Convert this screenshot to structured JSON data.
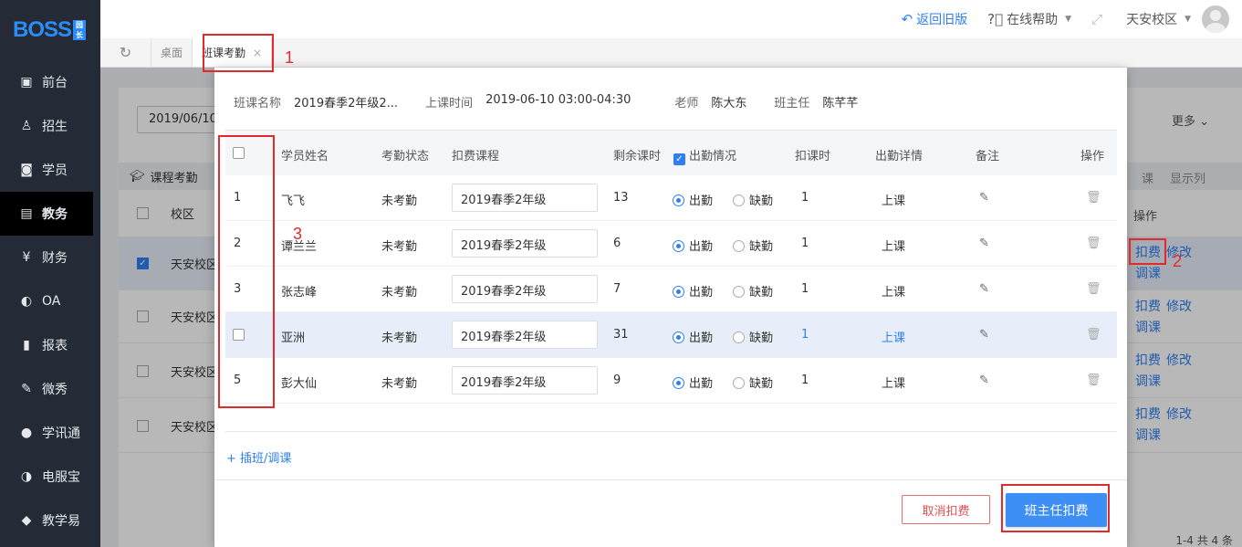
{
  "logo": {
    "text": "BOSS",
    "badge": "园长"
  },
  "sidebar": {
    "items": [
      {
        "label": "前台",
        "icon": "calendar-icon"
      },
      {
        "label": "招生",
        "icon": "user-plus-icon"
      },
      {
        "label": "学员",
        "icon": "id-card-icon"
      },
      {
        "label": "教务",
        "icon": "book-icon",
        "active": true
      },
      {
        "label": "财务",
        "icon": "yen-icon"
      },
      {
        "label": "OA",
        "icon": "chat-icon"
      },
      {
        "label": "报表",
        "icon": "bar-chart-icon"
      },
      {
        "label": "微秀",
        "icon": "xiu-icon"
      },
      {
        "label": "学讯通",
        "icon": "location-icon"
      },
      {
        "label": "电服宝",
        "icon": "phone-icon"
      },
      {
        "label": "教学易",
        "icon": "book-open-icon"
      }
    ]
  },
  "topbar": {
    "back_old": "返回旧版",
    "help": "在线帮助",
    "campus": "天安校区"
  },
  "tabs": {
    "desktop": "桌面",
    "active": "班课考勤",
    "close": "×"
  },
  "background": {
    "date": "2019/06/10",
    "more": "更多",
    "section_title": "课程考勤",
    "right_actions": [
      "课",
      "显示列"
    ],
    "col_campus": "校区",
    "col_ops": "操作",
    "rows": [
      {
        "campus": "天安校区",
        "checked": true
      },
      {
        "campus": "天安校区",
        "checked": false
      },
      {
        "campus": "天安校区",
        "checked": false
      },
      {
        "campus": "天安校区",
        "checked": false
      }
    ],
    "ops": {
      "charge": "扣费",
      "modify": "修改",
      "reschedule": "调课"
    },
    "pager": "1-4  共 4 条"
  },
  "modal": {
    "info": {
      "class_label": "班课名称",
      "class_value": "2019春季2年级2...",
      "time_label": "上课时间",
      "time_value": "2019-06-10 03:00-04:30",
      "teacher_label": "老师",
      "teacher_value": "陈大东",
      "head_label": "班主任",
      "head_value": "陈芊芊"
    },
    "columns": {
      "name": "学员姓名",
      "status": "考勤状态",
      "course": "扣费课程",
      "remaining": "剩余课时",
      "attendance": "出勤情况",
      "deduct": "扣课时",
      "detail": "出勤详情",
      "note": "备注",
      "ops": "操作"
    },
    "rows": [
      {
        "no": "1",
        "name": "飞飞",
        "status": "未考勤",
        "course": "2019春季2年级",
        "remaining": "13",
        "deduct": "1",
        "detail": "上课"
      },
      {
        "no": "2",
        "name": "谭兰兰",
        "status": "未考勤",
        "course": "2019春季2年级",
        "remaining": "6",
        "deduct": "1",
        "detail": "上课"
      },
      {
        "no": "3",
        "name": "张志峰",
        "status": "未考勤",
        "course": "2019春季2年级",
        "remaining": "7",
        "deduct": "1",
        "detail": "上课"
      },
      {
        "no": "",
        "name": "亚洲",
        "status": "未考勤",
        "course": "2019春季2年级",
        "remaining": "31",
        "deduct": "1",
        "detail": "上课"
      },
      {
        "no": "5",
        "name": "彭大仙",
        "status": "未考勤",
        "course": "2019春季2年级",
        "remaining": "9",
        "deduct": "1",
        "detail": "上课"
      }
    ],
    "present": "出勤",
    "absent": "缺勤",
    "add_link": "+ 插班/调课",
    "cancel_btn": "取消扣费",
    "confirm_btn": "班主任扣费"
  },
  "annotations": [
    "1",
    "2",
    "3"
  ],
  "colors": {
    "accent": "#2f7ff0",
    "annotation": "#e12a2a",
    "sidebar": "#242b36"
  }
}
